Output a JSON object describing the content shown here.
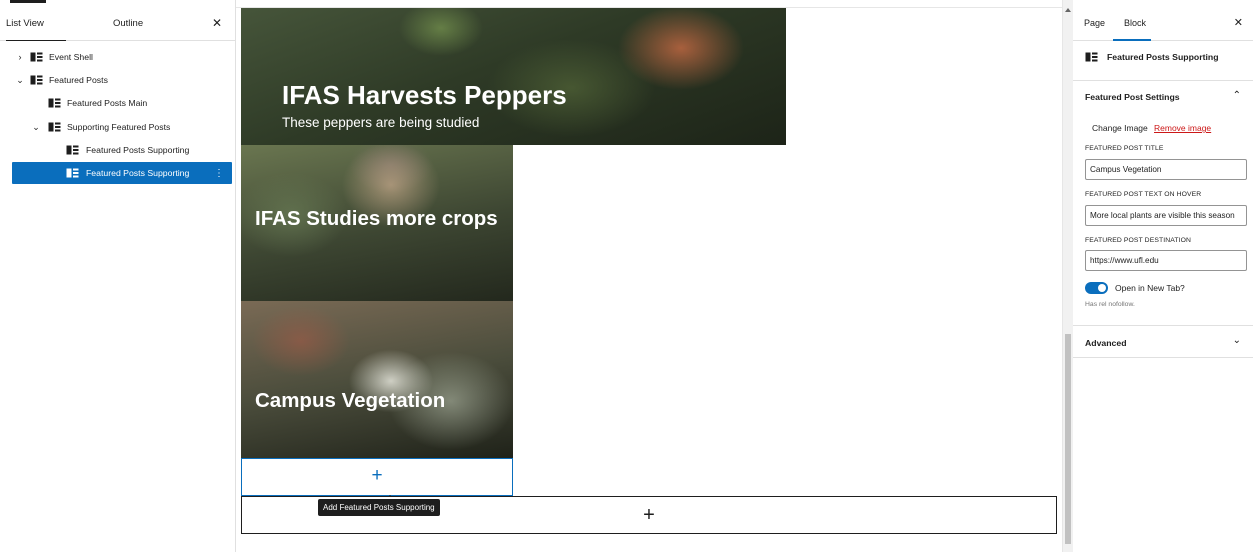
{
  "list_view": {
    "tabs": [
      {
        "label": "List View",
        "active": true
      },
      {
        "label": "Outline",
        "active": false
      }
    ],
    "close_icon": "close-icon",
    "tree": [
      {
        "label": "Event Shell",
        "expanded": false,
        "depth": 0
      },
      {
        "label": "Featured Posts",
        "expanded": true,
        "depth": 0
      },
      {
        "label": "Featured Posts Main",
        "depth": 1
      },
      {
        "label": "Supporting Featured Posts",
        "expanded": true,
        "depth": 1
      },
      {
        "label": "Featured Posts Supporting",
        "depth": 2
      },
      {
        "label": "Featured Posts Supporting",
        "depth": 2,
        "selected": true
      }
    ]
  },
  "canvas": {
    "hero": {
      "title": "IFAS Harvests Peppers",
      "subtitle": "These peppers are being studied"
    },
    "cards": [
      {
        "title": "IFAS Studies more crops"
      },
      {
        "title": "Campus Vegetation"
      }
    ],
    "appender_symbol": "+",
    "tooltip": "Add Featured Posts Supporting",
    "outer_appender_symbol": "+"
  },
  "inspector": {
    "tabs": [
      {
        "label": "Page",
        "active": false
      },
      {
        "label": "Block",
        "active": true
      }
    ],
    "block_title": "Featured Posts Supporting",
    "settings_panel": {
      "title": "Featured Post Settings",
      "change_image": "Change Image",
      "remove_image": "Remove image",
      "fields": [
        {
          "label": "FEATURED POST TITLE",
          "value": "Campus Vegetation"
        },
        {
          "label": "FEATURED POST TEXT ON HOVER",
          "value": "More local plants are visible this season"
        },
        {
          "label": "FEATURED POST DESTINATION",
          "value": "https://www.ufl.edu"
        }
      ],
      "toggle_label": "Open in New Tab?",
      "toggle_on": true,
      "help_text": "Has rel nofollow."
    },
    "advanced_label": "Advanced"
  },
  "colors": {
    "accent": "#0a6ebd",
    "remove": "#cc1818",
    "selected_row": "#0a6ebd"
  }
}
